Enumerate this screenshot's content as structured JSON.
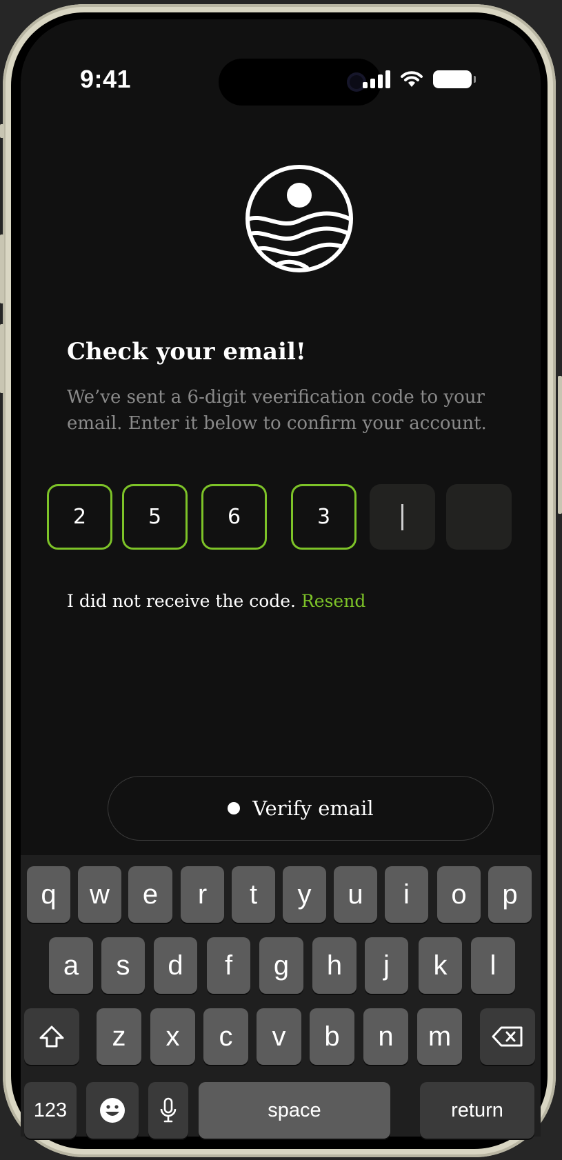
{
  "status_bar": {
    "time": "9:41"
  },
  "colors": {
    "accent": "#7dc328",
    "background": "#111111",
    "muted_text": "#8a8a8a",
    "empty_box": "#222220"
  },
  "header": {
    "title": "Check your email!",
    "subtitle": "We’ve sent a 6-digit veerification code to your email. Enter it below to confirm your account."
  },
  "code_input": {
    "digits": [
      "2",
      "5",
      "6",
      "3",
      "",
      ""
    ],
    "separator": "-",
    "active_index": 4
  },
  "resend": {
    "prompt": "I did not receive the code.",
    "link": "Resend"
  },
  "verify_button": {
    "label": "Verify email",
    "icon": "dot-icon"
  },
  "keyboard": {
    "row1": [
      "q",
      "w",
      "e",
      "r",
      "t",
      "y",
      "u",
      "i",
      "o",
      "p"
    ],
    "row2": [
      "a",
      "s",
      "d",
      "f",
      "g",
      "h",
      "j",
      "k",
      "l"
    ],
    "row3": [
      "z",
      "x",
      "c",
      "v",
      "b",
      "n",
      "m"
    ],
    "numbers_key": "123",
    "space_key": "space",
    "return_key": "return",
    "shift_icon": "shift-icon",
    "delete_icon": "delete-icon",
    "emoji_icon": "emoji-icon",
    "mic_icon": "microphone-icon"
  }
}
